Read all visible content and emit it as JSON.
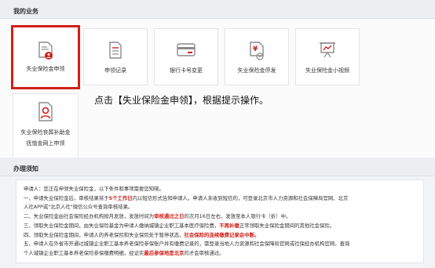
{
  "sections": {
    "my_business": "我的业务",
    "guide": "办理须知"
  },
  "tiles": [
    {
      "label": "失业保险金申领",
      "icon": "document-person-icon"
    },
    {
      "label": "申领记录",
      "icon": "document-list-icon"
    },
    {
      "label": "银行卡号变更",
      "icon": "bank-card-icon"
    },
    {
      "label": "失业保险金停发",
      "icon": "document-yen-icon"
    },
    {
      "label": "失业保险金小视频",
      "icon": "presentation-icon"
    }
  ],
  "tile_extra": {
    "line1": "失业保险丧葬补助金",
    "line2": "抚恤金网上申领",
    "icon": "person-card-icon"
  },
  "hint": "点击【失业保险金申领】，根据提示操作。",
  "notice": {
    "intro": "申请人：您正在申领失业保险金，以下条件和事项需要您知晓。",
    "l1a": "一、申请失业保险金后，审核结果将于",
    "l1red": "5个工作日",
    "l1b": "内以短信形式告知申请人。申请人未收到短信的，可登录北京市人力资源和社会保障局官网、北京",
    "l1c": "人社APP或\"北京人社\"微信公众号查询审核结果。",
    "l2a": "二、失业保险金由社会保险经办机构按月发放，发放时间为",
    "l2red": "审核通过之日",
    "l2b": "的次月16日左右，发放至本人银行卡（折）中。",
    "l3a": "三、领取失业保险金期间，由失业保险基金为申请人缴纳城镇企业职工基本医疗保险费，",
    "l3red": "不再补缴",
    "l3b": "正常领取失业保险金期间的其他社会保险。",
    "l4a": "四、领取失业保险金期间，申请人的养老保险和失业保险处于暂停状态，",
    "l4red": "社会保险的连续缴费记录会中断。",
    "l5": "五、申请人在外省市开通过城镇企业职工基本养老保险参保账户并有缴费记录的，需登录当地人力资源和社会保障局官网或社保经办机构官网，查询",
    "l6a": "个人城镇企业职工基本养老保险参保缴费明细，经证实",
    "l6red": "最后参保地是北京",
    "l6b": "的才会审核通过。"
  },
  "colors": {
    "accent": "#d0201a",
    "icon": "#8a8a8a"
  }
}
